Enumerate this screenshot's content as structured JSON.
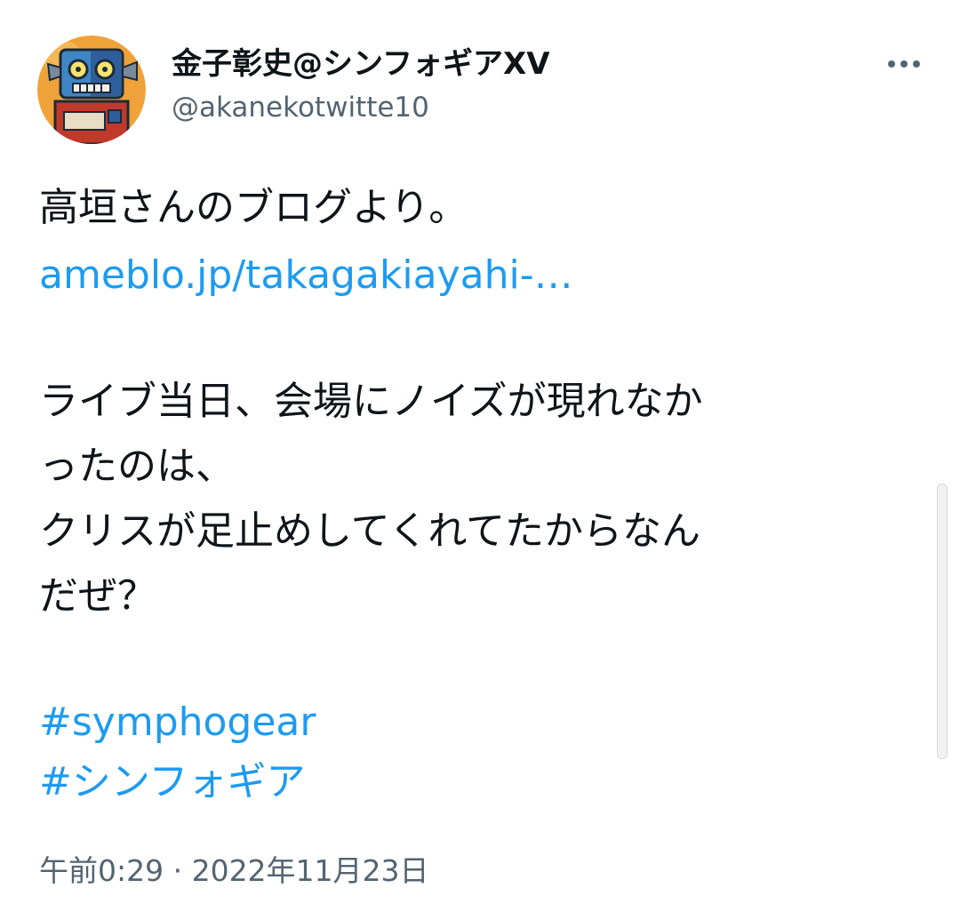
{
  "tweet": {
    "author": {
      "display_name": "金子彰史@シンフォギアXV",
      "handle": "@akanekotwitte10"
    },
    "lines": {
      "line1": "高垣さんのブログより。",
      "link": "ameblo.jp/takagakiayahi-…",
      "line3": "ライブ当日、会場にノイズが現れなか",
      "line4": "ったのは、",
      "line5": "クリスが足止めしてくれてたからなん",
      "line6": "だぜ？",
      "hashtag1": "#symphogear",
      "hashtag2": "#シンフォギア"
    },
    "timestamp": "午前0:29 · 2022年11月23日"
  },
  "icons": {
    "avatar": "robot-avatar",
    "more": "more-horizontal-icon"
  },
  "colors": {
    "link": "#1d9bf0",
    "text": "#0f1419",
    "secondary": "#536471"
  }
}
